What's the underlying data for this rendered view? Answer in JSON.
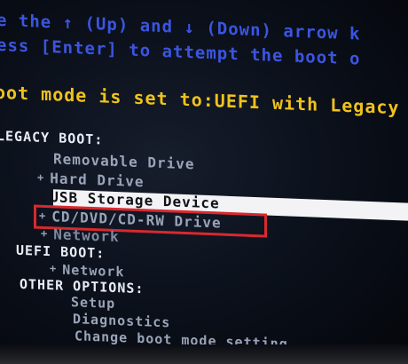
{
  "instructions": {
    "line1": "e the ↑ (Up) and ↓ (Down) arrow k",
    "line2": "ess [Enter] to attempt the boot o"
  },
  "boot_mode": {
    "text": "oot mode is set to:UEFI with Legacy"
  },
  "legacy_boot": {
    "heading": "LEGACY BOOT:",
    "items": [
      {
        "label": "Removable Drive",
        "bullet": ""
      },
      {
        "label": "Hard Drive",
        "bullet": "+"
      },
      {
        "label": "USB Storage Device",
        "bullet": "+",
        "selected": true
      },
      {
        "label": "CD/DVD/CD-RW Drive",
        "bullet": "+",
        "highlighted": true
      },
      {
        "label": "Network",
        "bullet": "+"
      }
    ]
  },
  "uefi_boot": {
    "heading": "UEFI BOOT:",
    "items": [
      {
        "label": "Network",
        "bullet": "+"
      }
    ]
  },
  "other_options": {
    "heading": "OTHER OPTIONS:",
    "items": [
      {
        "label": "Setup"
      },
      {
        "label": "Diagnostics"
      },
      {
        "label": "Change boot mode setting"
      }
    ]
  },
  "colors": {
    "instruction_text": "#3b55e0",
    "boot_mode_text": "#f0c21c",
    "selection_bar": "#f3f3f6",
    "highlight_box": "#d8292e"
  }
}
